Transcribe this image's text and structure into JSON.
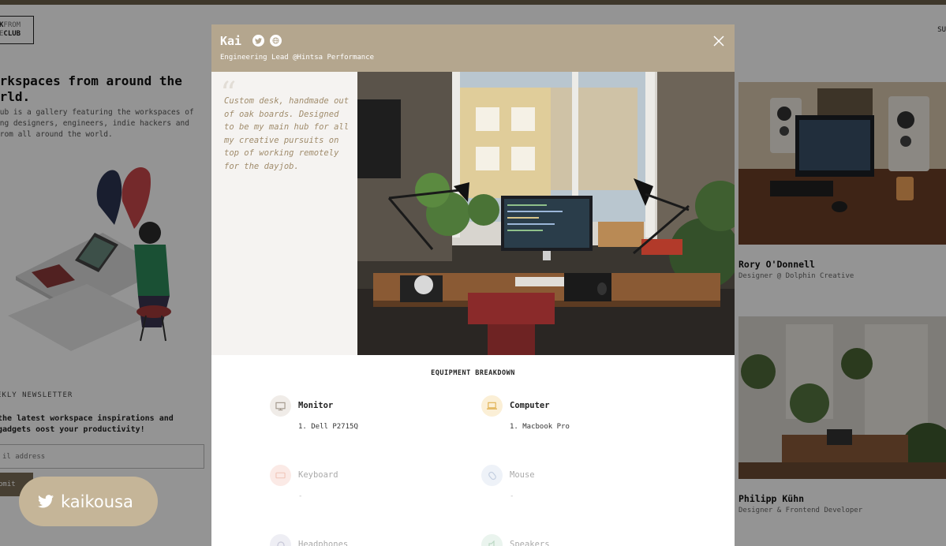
{
  "background": {
    "logo": {
      "line1a": "K",
      "line1b": "FROM",
      "line2a": "E",
      "line2b": "CLUB"
    },
    "top_right": "SU",
    "hero_title": "orkspaces from around the orld.",
    "hero_text": "lub is a gallery featuring the workspaces of ing designers, engineers, indie hackers and from all around the world.",
    "newsletter_label": "EKLY NEWSLETTER",
    "newsletter_text": "the latest workspace inspirations and gadgets oost your productivity!",
    "email_placeholder": "il address",
    "submit_label": "bmit",
    "cards": [
      {
        "name": "Rory O'Donnell",
        "role": "Designer @ Dolphin Creative"
      },
      {
        "name": "Philipp Kühn",
        "role": "Designer & Frontend Developer"
      }
    ]
  },
  "modal": {
    "name": "Kai",
    "subtitle": "Engineering Lead @Hintsa Performance",
    "quote_mark": "“",
    "quote": "Custom desk, handmade out of oak boards. Designed to be my main hub for all my creative pursuits on top of working remotely for the dayjob.",
    "section_title": "EQUIPMENT BREAKDOWN",
    "equipment": [
      {
        "category": "Monitor",
        "item": "1. Dell P2715Q",
        "icon": "monitor-icon"
      },
      {
        "category": "Computer",
        "item": "1. Macbook Pro",
        "icon": "laptop-icon"
      },
      {
        "category": "Keyboard",
        "item": "-",
        "icon": "keyboard-icon"
      },
      {
        "category": "Mouse",
        "item": "-",
        "icon": "mouse-icon"
      },
      {
        "category": "Headphones",
        "item": "",
        "icon": "headphones-icon"
      },
      {
        "category": "Speakers",
        "item": "",
        "icon": "speaker-icon"
      }
    ]
  },
  "twitter_pill": {
    "handle": "kaikousa",
    "icon": "twitter-icon"
  },
  "colors": {
    "header": "#b4a68e",
    "quote_text": "#a08c6c",
    "pill": "#c5b598",
    "overlay": "rgba(0,0,0,0.42)"
  }
}
